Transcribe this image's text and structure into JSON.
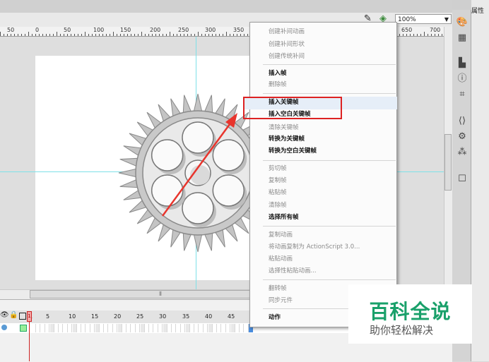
{
  "editbar": {
    "zoom": "100%"
  },
  "ruler": {
    "labels": [
      "50",
      "0",
      "50",
      "100",
      "150",
      "200",
      "250",
      "300",
      "350",
      "650",
      "700"
    ]
  },
  "context_menu": {
    "items": [
      {
        "label": "创建补间动画",
        "enabled": false
      },
      {
        "label": "创建补间形状",
        "enabled": false
      },
      {
        "label": "创建传统补间",
        "enabled": false
      },
      {
        "label": "插入帧",
        "enabled": true
      },
      {
        "label": "删除帧",
        "enabled": false
      },
      {
        "label": "插入关键帧",
        "enabled": true
      },
      {
        "label": "插入空白关键帧",
        "enabled": true
      },
      {
        "label": "清除关键帧",
        "enabled": false
      },
      {
        "label": "转换为关键帧",
        "enabled": true
      },
      {
        "label": "转换为空白关键帧",
        "enabled": true
      },
      {
        "label": "剪切帧",
        "enabled": false
      },
      {
        "label": "复制帧",
        "enabled": false
      },
      {
        "label": "粘贴帧",
        "enabled": false
      },
      {
        "label": "清除帧",
        "enabled": false
      },
      {
        "label": "选择所有帧",
        "enabled": true
      },
      {
        "label": "复制动画",
        "enabled": false
      },
      {
        "label": "将动画复制为 ActionScript 3.0...",
        "enabled": false
      },
      {
        "label": "粘贴动画",
        "enabled": false
      },
      {
        "label": "选择性粘贴动画...",
        "enabled": false
      },
      {
        "label": "翻转帧",
        "enabled": false
      },
      {
        "label": "同步元件",
        "enabled": false
      },
      {
        "label": "动作",
        "enabled": true
      }
    ]
  },
  "timeline": {
    "frame_numbers": [
      "1",
      "5",
      "10",
      "15",
      "20",
      "25",
      "30",
      "35",
      "40",
      "45"
    ]
  },
  "right_panel": {
    "title": "属性"
  },
  "watermark": {
    "title": "百科全说",
    "subtitle": "助你轻松解决"
  },
  "colors": {
    "highlight_box": "#dd2222",
    "guide": "#7ee1e8",
    "watermark": "#19a06a"
  }
}
